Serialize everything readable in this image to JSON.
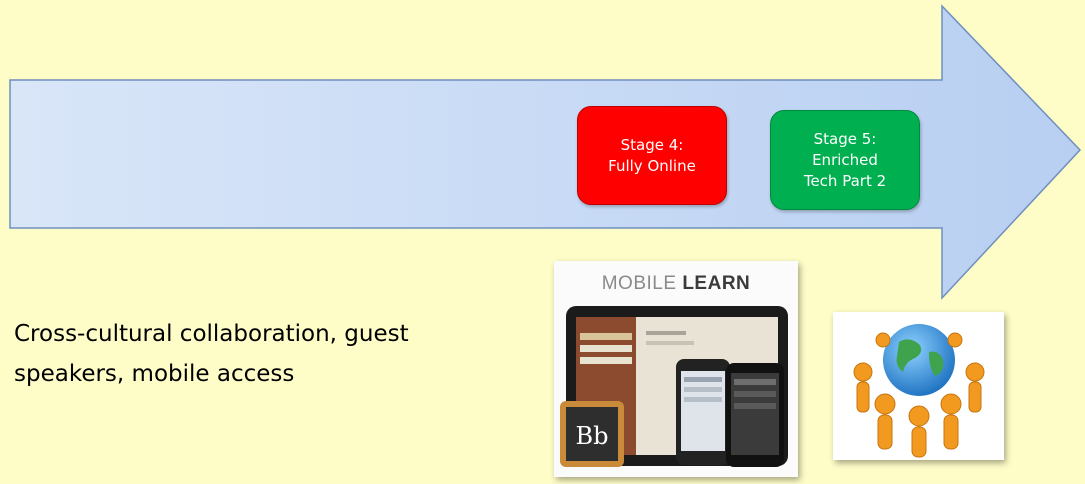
{
  "stages": [
    {
      "lines": [
        "Stage 4:",
        "Fully Online"
      ],
      "color": "#ff0000"
    },
    {
      "lines": [
        "Stage 5:",
        "Enriched",
        "Tech Part 2"
      ],
      "color": "#00b050"
    }
  ],
  "caption": {
    "line1": "Cross-cultural collaboration, guest",
    "line2": "speakers, mobile access"
  },
  "mobile_learn": {
    "word1": "MOBILE",
    "word2": "LEARN",
    "badge": "Bb"
  },
  "colors": {
    "background": "#fefdc8",
    "arrow": "#c6d9f5",
    "arrow_outline": "#6f8fbf"
  }
}
